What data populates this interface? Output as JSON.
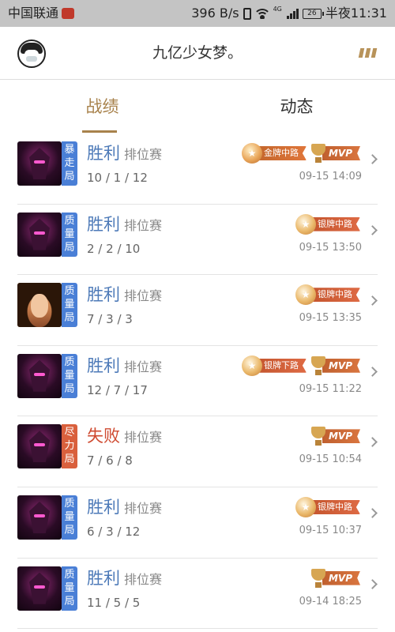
{
  "status_bar": {
    "carrier": "中国联通",
    "net_speed": "396 B/s",
    "network_type": "4G",
    "battery": "26",
    "time": "半夜11:31"
  },
  "header": {
    "title": "九亿少女梦。"
  },
  "tabs": [
    {
      "label": "战绩",
      "active": true
    },
    {
      "label": "动态",
      "active": false
    }
  ],
  "matches": [
    {
      "hero": "dark-knight",
      "tag": "暴走局",
      "tag_color": "#4a7fd6",
      "result": "胜利",
      "outcome": "win",
      "mode": "排位赛",
      "kda": "10 / 1 / 12",
      "datetime": "09-15 14:09",
      "badges": [
        {
          "type": "medal",
          "tier": "gold",
          "label": "金牌中路"
        },
        {
          "type": "mvp",
          "label": "MVP"
        }
      ]
    },
    {
      "hero": "dark-knight",
      "tag": "质量局",
      "tag_color": "#4a7fd6",
      "result": "胜利",
      "outcome": "win",
      "mode": "排位赛",
      "kda": "2 / 2 / 10",
      "datetime": "09-15 13:50",
      "badges": [
        {
          "type": "medal",
          "tier": "silver",
          "label": "银牌中路"
        }
      ]
    },
    {
      "hero": "heroine",
      "tag": "质量局",
      "tag_color": "#4a7fd6",
      "result": "胜利",
      "outcome": "win",
      "mode": "排位赛",
      "kda": "7 / 3 / 3",
      "datetime": "09-15 13:35",
      "badges": [
        {
          "type": "medal",
          "tier": "silver",
          "label": "银牌中路"
        }
      ]
    },
    {
      "hero": "dark-knight",
      "tag": "质量局",
      "tag_color": "#4a7fd6",
      "result": "胜利",
      "outcome": "win",
      "mode": "排位赛",
      "kda": "12 / 7 / 17",
      "datetime": "09-15 11:22",
      "badges": [
        {
          "type": "medal",
          "tier": "silver",
          "label": "银牌下路"
        },
        {
          "type": "mvp",
          "label": "MVP"
        }
      ]
    },
    {
      "hero": "dark-knight",
      "tag": "尽力局",
      "tag_color": "#d9603d",
      "result": "失败",
      "outcome": "loss",
      "mode": "排位赛",
      "kda": "7 / 6 / 8",
      "datetime": "09-15 10:54",
      "badges": [
        {
          "type": "mvp",
          "label": "MVP"
        }
      ]
    },
    {
      "hero": "dark-knight",
      "tag": "质量局",
      "tag_color": "#4a7fd6",
      "result": "胜利",
      "outcome": "win",
      "mode": "排位赛",
      "kda": "6 / 3 / 12",
      "datetime": "09-15 10:37",
      "badges": [
        {
          "type": "medal",
          "tier": "silver",
          "label": "银牌中路"
        }
      ]
    },
    {
      "hero": "dark-knight",
      "tag": "质量局",
      "tag_color": "#4a7fd6",
      "result": "胜利",
      "outcome": "win",
      "mode": "排位赛",
      "kda": "11 / 5 / 5",
      "datetime": "09-14 18:25",
      "badges": [
        {
          "type": "mvp",
          "label": "MVP"
        }
      ]
    }
  ],
  "colors": {
    "accent": "#a8824c",
    "win": "#4d7ab8",
    "loss": "#cf4a30"
  }
}
